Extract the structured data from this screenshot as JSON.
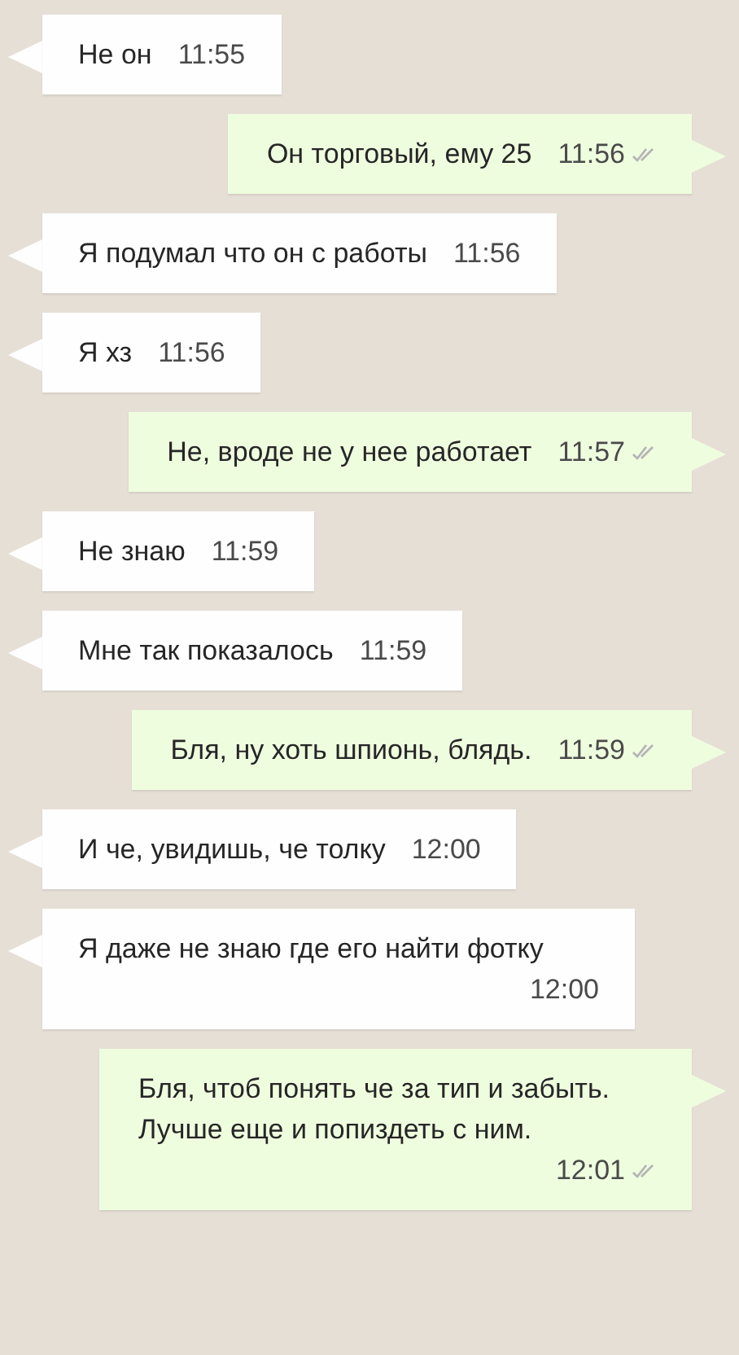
{
  "messages": [
    {
      "kind": "incoming",
      "text": "Не он",
      "time": "11:55"
    },
    {
      "kind": "outgoing",
      "text": "Он торговый, ему 25",
      "time": "11:56",
      "read": false
    },
    {
      "kind": "incoming",
      "text": "Я подумал что он с работы",
      "time": "11:56"
    },
    {
      "kind": "incoming",
      "text": "Я хз",
      "time": "11:56"
    },
    {
      "kind": "outgoing",
      "text": "Не, вроде не у нее работает",
      "time": "11:57",
      "read": false
    },
    {
      "kind": "incoming",
      "text": "Не знаю",
      "time": "11:59"
    },
    {
      "kind": "incoming",
      "text": "Мне так показалось",
      "time": "11:59"
    },
    {
      "kind": "outgoing",
      "text": "Бля, ну хоть шпионь, блядь.",
      "time": "11:59",
      "read": false
    },
    {
      "kind": "incoming",
      "text": "И че, увидишь, че толку",
      "time": "12:00"
    },
    {
      "kind": "incoming",
      "text": "Я даже не знаю где его найти фотку",
      "time": "12:00"
    },
    {
      "kind": "outgoing",
      "text": "Бля, чтоб понять че за тип и забыть. Лучше еще и попиздеть с ним.",
      "time": "12:01",
      "read": false
    }
  ]
}
